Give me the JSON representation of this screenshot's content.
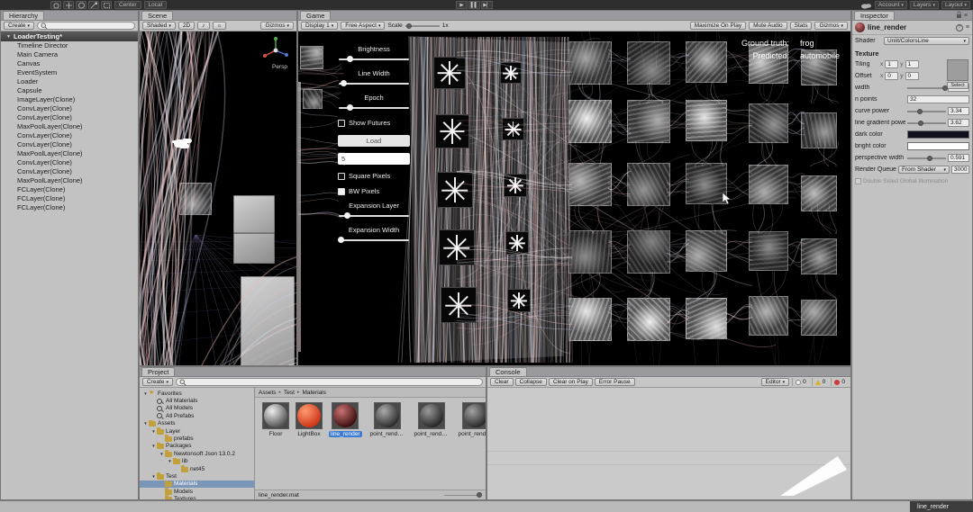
{
  "visual": {
    "accent": "#3e7dd6",
    "line_colors": [
      "#ffffff",
      "#f7dcdc",
      "#dde2f7",
      "#f2c8c8",
      "#c9d3f0",
      "#eeb9b9"
    ],
    "grid_color": "#7a68a0"
  },
  "toolbar": {
    "pivot": "Center",
    "rotation": "Local",
    "account": "Account",
    "layers": "Layers",
    "layout": "Layout"
  },
  "statusbar": {
    "selected_asset": "line_render"
  },
  "hierarchy": {
    "tab": "Hierarchy",
    "create": "Create",
    "scene_name": "LoaderTesting*",
    "items": [
      "Timeline Director",
      "Main Camera",
      "Canvas",
      "EventSystem",
      "Loader",
      "Capsule",
      "ImageLayer(Clone)",
      "ConvLayer(Clone)",
      "ConvLayer(Clone)",
      "MaxPoolLayer(Clone)",
      "ConvLayer(Clone)",
      "ConvLayer(Clone)",
      "MaxPoolLayer(Clone)",
      "ConvLayer(Clone)",
      "ConvLayer(Clone)",
      "MaxPoolLayer(Clone)",
      "FCLayer(Clone)",
      "FCLayer(Clone)",
      "FCLayer(Clone)"
    ]
  },
  "scene_view": {
    "tab": "Scene",
    "shading": "Shaded",
    "mode_2d": "2D",
    "gizmos": "Gizmos",
    "persp_label": "Persp"
  },
  "game_view": {
    "tab": "Game",
    "display": "Display 1",
    "aspect": "Free Aspect",
    "scale_label": "Scale",
    "scale_value": "1x",
    "maximize": "Maximize On Play",
    "mute": "Mute Audio",
    "stats": "Stats",
    "gizmos": "Gizmos",
    "hud": {
      "ground_truth_label": "Ground truth:",
      "ground_truth_value": "frog",
      "predicted_label": "Predicted:",
      "predicted_value": "automobile"
    },
    "controls": [
      {
        "type": "slider",
        "label": "Brightness",
        "t": 0.15
      },
      {
        "type": "slider",
        "label": "Line Width",
        "t": 0.06
      },
      {
        "type": "slider",
        "label": "Epoch",
        "t": 0.15
      },
      {
        "type": "checkbox",
        "label": "Show Futures",
        "checked": false
      },
      {
        "type": "button",
        "label": "Load"
      },
      {
        "type": "input",
        "value": "5"
      },
      {
        "type": "checkbox",
        "label": "Square Pixels",
        "checked": false
      },
      {
        "type": "checkbox",
        "label": "BW Pixels",
        "checked": true
      },
      {
        "type": "slider",
        "label": "Expansion Layer",
        "t": 0.12
      },
      {
        "type": "slider",
        "label": "Expansion Width",
        "t": 0.03
      }
    ]
  },
  "inspector": {
    "tab": "Inspector",
    "material_name": "line_render",
    "shader_label": "Shader",
    "shader_value": "Unlit/ColorsLine",
    "texture_section": "Texture",
    "tiling_label": "Tiling",
    "offset_label": "Offset",
    "x_label": "x",
    "y_label": "y",
    "tiling_x": "1",
    "tiling_y": "1",
    "offset_x": "0",
    "offset_y": "0",
    "select_label": "Select",
    "properties": [
      {
        "label": "width",
        "type": "slider",
        "value": "0.9872",
        "t": 0.97
      },
      {
        "label": "n points",
        "type": "field",
        "value": "32"
      },
      {
        "label": "curve power",
        "type": "slider",
        "value": "3.34",
        "t": 0.33
      },
      {
        "label": "line gradient power",
        "type": "slider",
        "value": "3.62",
        "t": 0.36
      },
      {
        "label": "dark color",
        "type": "color",
        "value": "#101020"
      },
      {
        "label": "bright color",
        "type": "color",
        "value": "#ffffff"
      },
      {
        "label": "perspective width",
        "type": "slider",
        "value": "0.591",
        "t": 0.59
      }
    ],
    "render_queue_label": "Render Queue",
    "render_queue_mode": "From Shader",
    "render_queue_value": "3000",
    "gi_label": "Double Sided Global Illumination"
  },
  "project": {
    "tab": "Project",
    "create": "Create",
    "breadcrumb": [
      "Assets",
      "Test",
      "Materials"
    ],
    "tree": [
      {
        "label": "Favorites",
        "depth": 0,
        "icon": "star",
        "arrow": "▼"
      },
      {
        "label": "All Materials",
        "depth": 1,
        "icon": "search",
        "arrow": ""
      },
      {
        "label": "All Models",
        "depth": 1,
        "icon": "search",
        "arrow": ""
      },
      {
        "label": "All Prefabs",
        "depth": 1,
        "icon": "search",
        "arrow": ""
      },
      {
        "label": "Assets",
        "depth": 0,
        "icon": "folder",
        "arrow": "▼"
      },
      {
        "label": "Layer",
        "depth": 1,
        "icon": "folder",
        "arrow": "▼"
      },
      {
        "label": "prefabs",
        "depth": 2,
        "icon": "folder",
        "arrow": ""
      },
      {
        "label": "Packages",
        "depth": 1,
        "icon": "folder",
        "arrow": "▼"
      },
      {
        "label": "Newtonsoft Json 13.0.2",
        "depth": 2,
        "icon": "folder",
        "arrow": "▼"
      },
      {
        "label": "lib",
        "depth": 3,
        "icon": "folder",
        "arrow": "▼"
      },
      {
        "label": "net45",
        "depth": 4,
        "icon": "folder",
        "arrow": ""
      },
      {
        "label": "Test",
        "depth": 1,
        "icon": "folder",
        "arrow": "▼"
      },
      {
        "label": "Materials",
        "depth": 2,
        "icon": "folder",
        "arrow": "",
        "selected": true
      },
      {
        "label": "Models",
        "depth": 2,
        "icon": "folder",
        "arrow": ""
      },
      {
        "label": "Textures",
        "depth": 2,
        "icon": "folder",
        "arrow": ""
      }
    ],
    "assets": [
      {
        "name": "Floor",
        "hi": "#ededed",
        "lo": "#555555"
      },
      {
        "name": "LightBox",
        "hi": "#ff9a70",
        "lo": "#cc3516"
      },
      {
        "name": "line_render",
        "hi": "#c87272",
        "lo": "#3d0d0d",
        "selected": true
      },
      {
        "name": "point_rende...",
        "hi": "#aaaaaa",
        "lo": "#2c2c2c"
      },
      {
        "name": "point_rende...",
        "hi": "#9a9a9a",
        "lo": "#262626"
      },
      {
        "name": "point_rende...",
        "hi": "#a2a2a2",
        "lo": "#292929"
      }
    ],
    "selected_file": "line_render.mat"
  },
  "console": {
    "tab": "Console",
    "buttons": [
      "Clear",
      "Collapse",
      "Clear on Play",
      "Error Pause"
    ],
    "editor": "Editor",
    "counts": {
      "info": "0",
      "warning": "0",
      "error": "0"
    }
  }
}
